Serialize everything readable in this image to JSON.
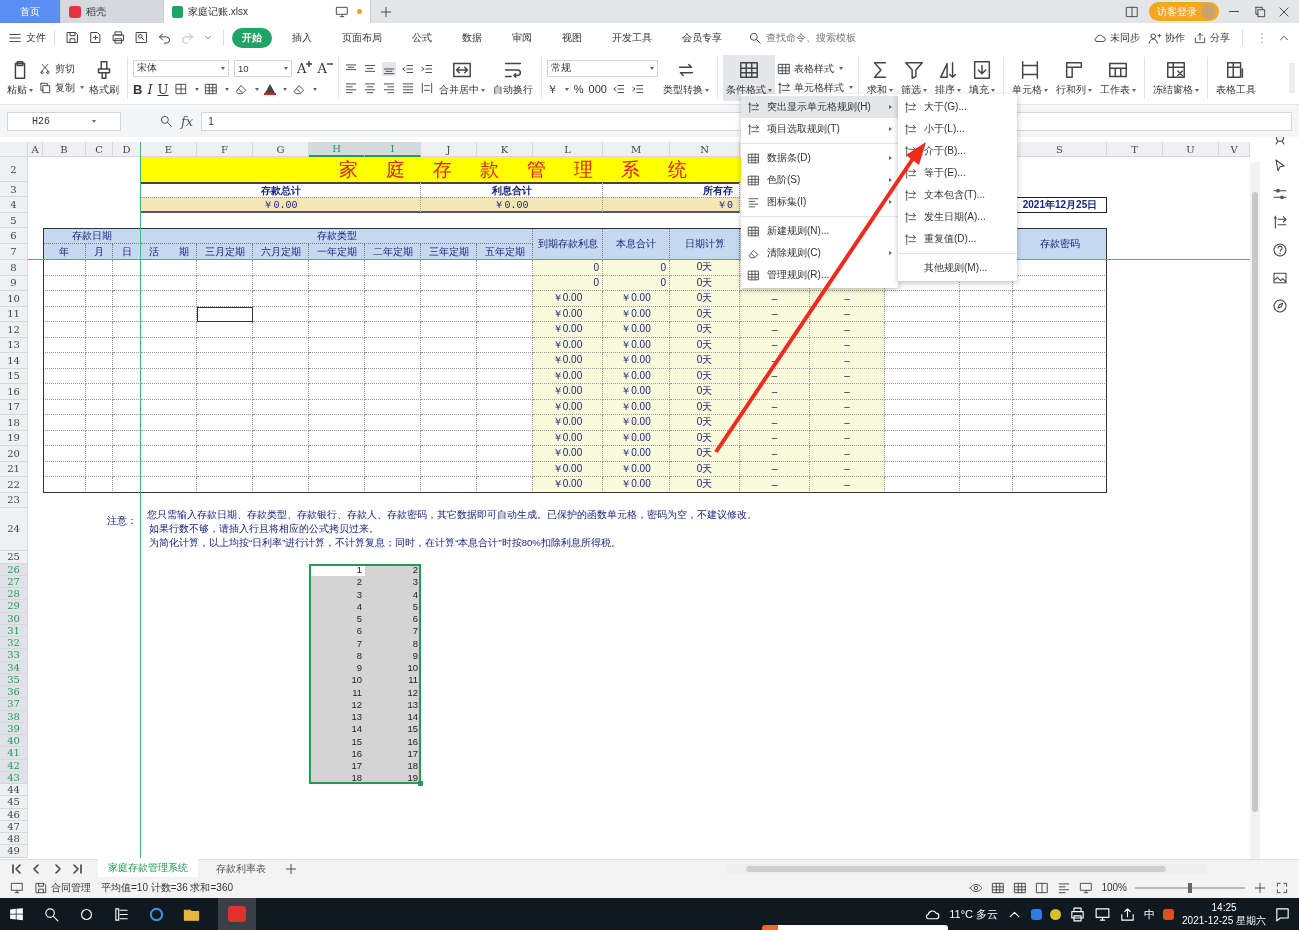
{
  "tabs": [
    {
      "label": "首页",
      "kind": "home",
      "selected": false
    },
    {
      "label": "稻壳",
      "kind": "docer",
      "selected": false
    },
    {
      "label": "家庭记账.xlsx",
      "kind": "file",
      "selected": true
    }
  ],
  "login": "访客登录",
  "menu_tabs": [
    {
      "label": "开始",
      "selected": true
    },
    {
      "label": "插入",
      "selected": false
    },
    {
      "label": "页面布局",
      "selected": false
    },
    {
      "label": "公式",
      "selected": false
    },
    {
      "label": "数据",
      "selected": false
    },
    {
      "label": "审阅",
      "selected": false
    },
    {
      "label": "视图",
      "selected": false
    },
    {
      "label": "开发工具",
      "selected": false
    },
    {
      "label": "会员专享",
      "selected": false
    }
  ],
  "file_menu": "文件",
  "search": {
    "placeholder": "查找命令、搜索模板"
  },
  "actions": [
    "未同步",
    "协作",
    "分享"
  ],
  "ribbon": {
    "paste": "粘贴",
    "cut": "剪切",
    "copy": "复制",
    "painter": "格式刷",
    "font": "宋体",
    "size": "10",
    "grow": "A",
    "shrink": "A",
    "styles": [
      "B",
      "I",
      "U"
    ],
    "merge": "合并居中",
    "wrap": "自动换行",
    "format": "常规",
    "number_symbols": [
      "￥",
      "%",
      "000"
    ],
    "convert": "类型转换",
    "cond": {
      "label": "条件格式",
      "selected": true
    },
    "table_style": "表格样式",
    "cell_style": "单元格样式",
    "tools": [
      "求和",
      "筛选",
      "排序",
      "填充",
      "单元格",
      "行和列",
      "工作表",
      "冻结窗格",
      "表格工具"
    ]
  },
  "formula_bar": {
    "name_box": "H26",
    "fx": "fx",
    "value": "1"
  },
  "columns": [
    {
      "label": "A",
      "selected": false
    },
    {
      "label": "B",
      "selected": false
    },
    {
      "label": "C",
      "selected": false
    },
    {
      "label": "D",
      "selected": false
    },
    {
      "label": "E",
      "selected": false
    },
    {
      "label": "F",
      "selected": false
    },
    {
      "label": "G",
      "selected": false
    },
    {
      "label": "H",
      "selected": true
    },
    {
      "label": "I",
      "selected": true
    },
    {
      "label": "J",
      "selected": false
    },
    {
      "label": "K",
      "selected": false
    },
    {
      "label": "L",
      "selected": false
    },
    {
      "label": "M",
      "selected": false
    },
    {
      "label": "N",
      "selected": false
    },
    {
      "label": "S",
      "selected": false
    },
    {
      "label": "T",
      "selected": false
    },
    {
      "label": "U",
      "selected": false
    },
    {
      "label": "V",
      "selected": false
    }
  ],
  "rows": [
    {
      "label": "2",
      "selected": false
    },
    {
      "label": "3",
      "selected": false
    },
    {
      "label": "4",
      "selected": false
    },
    {
      "label": "5",
      "selected": false
    },
    {
      "label": "6",
      "selected": false
    },
    {
      "label": "7",
      "selected": false
    },
    {
      "label": "8",
      "selected": false
    },
    {
      "label": "9",
      "selected": false
    },
    {
      "label": "10",
      "selected": false
    },
    {
      "label": "11",
      "selected": false
    },
    {
      "label": "12",
      "selected": false
    },
    {
      "label": "13",
      "selected": false
    },
    {
      "label": "14",
      "selected": false
    },
    {
      "label": "15",
      "selected": false
    },
    {
      "label": "16",
      "selected": false
    },
    {
      "label": "17",
      "selected": false
    },
    {
      "label": "18",
      "selected": false
    },
    {
      "label": "19",
      "selected": false
    },
    {
      "label": "20",
      "selected": false
    },
    {
      "label": "21",
      "selected": false
    },
    {
      "label": "22",
      "selected": false
    },
    {
      "label": "23",
      "selected": false
    },
    {
      "label": "24",
      "selected": false
    },
    {
      "label": "25",
      "selected": false
    },
    {
      "label": "26",
      "selected": true
    },
    {
      "label": "27",
      "selected": true
    },
    {
      "label": "28",
      "selected": true
    },
    {
      "label": "29",
      "selected": true
    },
    {
      "label": "30",
      "selected": true
    },
    {
      "label": "31",
      "selected": true
    },
    {
      "label": "32",
      "selected": true
    },
    {
      "label": "33",
      "selected": true
    },
    {
      "label": "34",
      "selected": true
    },
    {
      "label": "35",
      "selected": true
    },
    {
      "label": "36",
      "selected": true
    },
    {
      "label": "37",
      "selected": true
    },
    {
      "label": "38",
      "selected": true
    },
    {
      "label": "39",
      "selected": true
    },
    {
      "label": "40",
      "selected": true
    },
    {
      "label": "41",
      "selected": true
    },
    {
      "label": "42",
      "selected": true
    },
    {
      "label": "43",
      "selected": true
    },
    {
      "label": "44",
      "selected": false
    },
    {
      "label": "45",
      "selected": false
    },
    {
      "label": "46",
      "selected": false
    },
    {
      "label": "47",
      "selected": false
    },
    {
      "label": "48",
      "selected": false
    },
    {
      "label": "49",
      "selected": false
    }
  ],
  "sheet": {
    "title": "家庭存款管理系统",
    "summary": [
      {
        "label": "存款总计",
        "value": "￥0.00"
      },
      {
        "label": "利息合计",
        "value": "￥0.00"
      },
      {
        "label": "所有存",
        "value": "￥0"
      }
    ],
    "date": "2021年12月25日",
    "group_headers": [
      "存款日期",
      "存款类型"
    ],
    "sub_headers": [
      "年",
      "月",
      "日",
      "活　　期",
      "三月定期",
      "六月定期",
      "一年定期",
      "二年定期",
      "三年定期",
      "五年定期"
    ],
    "tall_headers": [
      "到期存款利息",
      "本息合计",
      "日期计算"
    ],
    "password_header": "存款密码",
    "data_rows": [
      [
        "0",
        "0",
        "0天"
      ],
      [
        "0",
        "0",
        "0天"
      ],
      [
        "￥0.00",
        "￥0.00",
        "0天",
        "–",
        "–"
      ],
      [
        "￥0.00",
        "￥0.00",
        "0天",
        "–",
        "–"
      ],
      [
        "￥0.00",
        "￥0.00",
        "0天",
        "–",
        "–"
      ],
      [
        "￥0.00",
        "￥0.00",
        "0天",
        "–",
        "–"
      ],
      [
        "￥0.00",
        "￥0.00",
        "0天",
        "–",
        "–"
      ],
      [
        "￥0.00",
        "￥0.00",
        "0天",
        "–",
        "–"
      ],
      [
        "￥0.00",
        "￥0.00",
        "0天",
        "–",
        "–"
      ],
      [
        "￥0.00",
        "￥0.00",
        "0天",
        "–",
        "–"
      ],
      [
        "￥0.00",
        "￥0.00",
        "0天",
        "–",
        "–"
      ],
      [
        "￥0.00",
        "￥0.00",
        "0天",
        "–",
        "–"
      ],
      [
        "￥0.00",
        "￥0.00",
        "0天",
        "–",
        "–"
      ],
      [
        "￥0.00",
        "￥0.00",
        "0天",
        "–",
        "–"
      ],
      [
        "￥0.00",
        "￥0.00",
        "0天",
        "–",
        "–"
      ]
    ],
    "note_label": "注意：",
    "notes": [
      "您只需输入存款日期、存款类型、存款银行、存款人、存款密码，其它数据即可自动生成。已保护的函数单元格，密码为空，不建议修改。",
      "如果行数不够，请插入行且将相应的公式拷贝过来。",
      "为简化计算，以上均按“日利率”进行计算，不计算复息；同时，在计算“本息合计”时按80%扣除利息所得税。"
    ],
    "block": [
      [
        "1",
        "2"
      ],
      [
        "2",
        "3"
      ],
      [
        "3",
        "4"
      ],
      [
        "4",
        "5"
      ],
      [
        "5",
        "6"
      ],
      [
        "6",
        "7"
      ],
      [
        "7",
        "8"
      ],
      [
        "8",
        "9"
      ],
      [
        "9",
        "10"
      ],
      [
        "10",
        "11"
      ],
      [
        "11",
        "12"
      ],
      [
        "12",
        "13"
      ],
      [
        "13",
        "14"
      ],
      [
        "14",
        "15"
      ],
      [
        "15",
        "16"
      ],
      [
        "16",
        "17"
      ],
      [
        "17",
        "18"
      ],
      [
        "18",
        "19"
      ]
    ]
  },
  "context_menu": [
    [
      {
        "label": "突出显示单元格规则(H)",
        "submenu": true,
        "selected": true
      },
      {
        "label": "项目选取规则(T)",
        "submenu": true,
        "selected": false
      }
    ],
    [
      {
        "label": "数据条(D)",
        "submenu": true,
        "selected": false
      },
      {
        "label": "色阶(S)",
        "submenu": true,
        "selected": false
      },
      {
        "label": "图标集(I)",
        "submenu": true,
        "selected": false
      }
    ],
    [
      {
        "label": "新建规则(N)...",
        "submenu": false,
        "selected": false
      },
      {
        "label": "清除规则(C)",
        "submenu": true,
        "selected": false
      },
      {
        "label": "管理规则(R)...",
        "submenu": false,
        "selected": false
      }
    ]
  ],
  "submenu": [
    [
      "大于(G)...",
      "小于(L)...",
      "介于(B)...",
      "等于(E)...",
      "文本包含(T)...",
      "发生日期(A)...",
      "重复值(D)..."
    ],
    [
      "其他规则(M)..."
    ]
  ],
  "sheet_tabs": [
    {
      "label": "家庭存款管理系统",
      "selected": true
    },
    {
      "label": "存款利率表",
      "selected": false
    }
  ],
  "status": {
    "app": "合同管理",
    "stats": "平均值=10 计数=36 求和=360",
    "zoom": "100%",
    "zoom_slider": {
      "level": 0.48
    }
  },
  "taskbar": {
    "weather": "11°C 多云",
    "ime": "中",
    "time": "14:25",
    "date": "2021-12-25 星期六"
  }
}
